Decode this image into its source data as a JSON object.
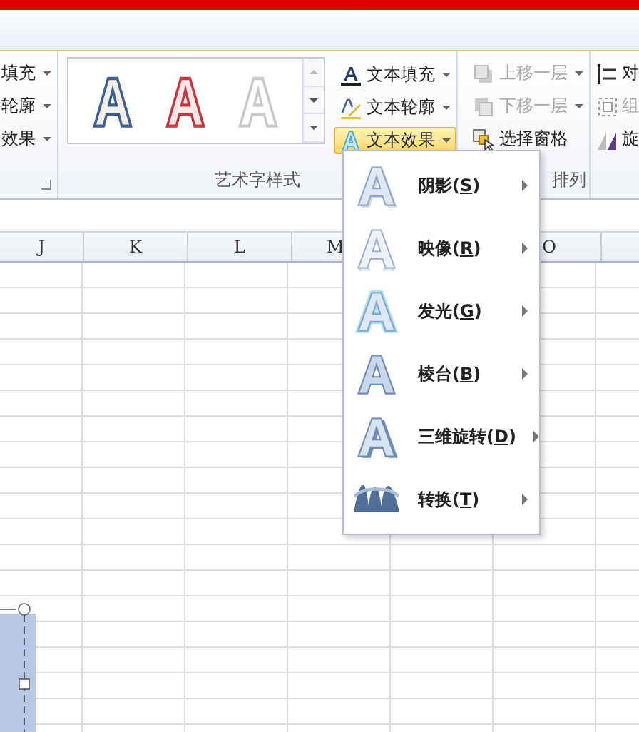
{
  "ribbon": {
    "left_group": {
      "items": [
        {
          "label": "填充"
        },
        {
          "label": "轮廓"
        },
        {
          "label": "效果"
        }
      ]
    },
    "wordart_group": {
      "label": "艺术字样式",
      "presets": [
        {
          "kind": "blue_outline"
        },
        {
          "kind": "red_outline"
        },
        {
          "kind": "white_soft"
        }
      ],
      "text_buttons": [
        {
          "label": "文本填充",
          "kind": "fill",
          "selected": false
        },
        {
          "label": "文本轮廓",
          "kind": "outline",
          "selected": false
        },
        {
          "label": "文本效果",
          "kind": "effects",
          "selected": true
        }
      ]
    },
    "arrange_group": {
      "label": "排列",
      "buttons": [
        {
          "label": "上移一层",
          "kind": "bring_forward",
          "disabled": true,
          "dropdown": true
        },
        {
          "label": "下移一层",
          "kind": "send_backward",
          "disabled": true,
          "dropdown": true
        },
        {
          "label": "选择窗格",
          "kind": "selection_pane",
          "disabled": false,
          "dropdown": false
        }
      ],
      "cut_buttons": [
        {
          "label": "对",
          "kind": "align",
          "disabled": false
        },
        {
          "label": "组",
          "kind": "group",
          "disabled": true
        },
        {
          "label": "旋",
          "kind": "rotate",
          "disabled": false
        }
      ]
    }
  },
  "columns": [
    {
      "label": "J"
    },
    {
      "label": "K"
    },
    {
      "label": "L"
    },
    {
      "label": "M"
    },
    {
      "label": "O"
    }
  ],
  "effects_menu": {
    "items": [
      {
        "kind": "shadow",
        "label": "阴影(",
        "access_key": "S",
        "label_end": ")"
      },
      {
        "kind": "reflection",
        "label": "映像(",
        "access_key": "R",
        "label_end": ")"
      },
      {
        "kind": "glow",
        "label": "发光(",
        "access_key": "G",
        "label_end": ")"
      },
      {
        "kind": "bevel",
        "label": "棱台(",
        "access_key": "B",
        "label_end": ")"
      },
      {
        "kind": "rotation_3d",
        "label": "三维旋转(",
        "access_key": "D",
        "label_end": ")"
      },
      {
        "kind": "transform",
        "label": "转换(",
        "access_key": "T",
        "label_end": ")"
      }
    ]
  }
}
